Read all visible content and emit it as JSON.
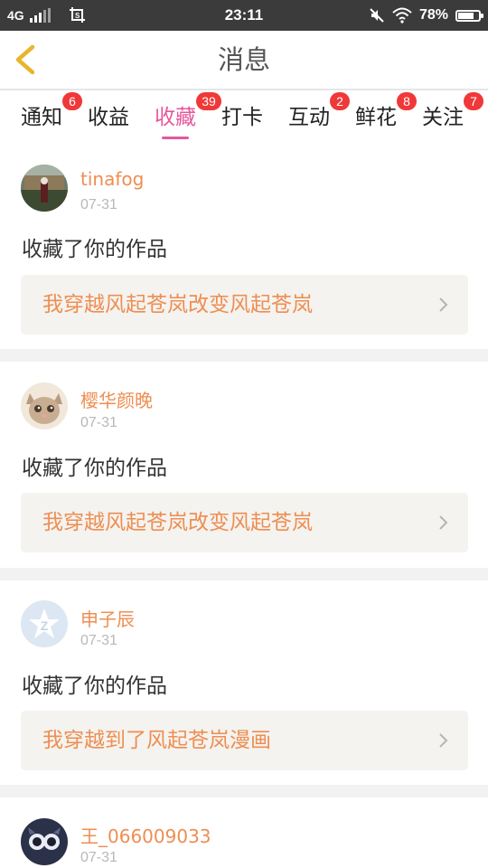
{
  "status_bar": {
    "network": "4G",
    "time": "23:11",
    "battery": "78%",
    "battery_level": 0.78
  },
  "header": {
    "title": "消息",
    "back_icon": "chevron-left-icon"
  },
  "tabs": [
    {
      "label": "通知",
      "badge": "6",
      "active": false
    },
    {
      "label": "收益",
      "badge": "",
      "active": false
    },
    {
      "label": "收藏",
      "badge": "39",
      "active": true
    },
    {
      "label": "打卡",
      "badge": "",
      "active": false
    },
    {
      "label": "互动",
      "badge": "2",
      "active": false
    },
    {
      "label": "鲜花",
      "badge": "8",
      "active": false
    },
    {
      "label": "关注",
      "badge": "7",
      "active": false
    }
  ],
  "notifications": [
    {
      "user": "tinafog",
      "date": "07-31",
      "action": "收藏了你的作品",
      "work": "我穿越风起苍岚改变风起苍岚",
      "avatar": "photo-avatar"
    },
    {
      "user": "樱华颜晚",
      "date": "07-31",
      "action": "收藏了你的作品",
      "work": "我穿越风起苍岚改变风起苍岚",
      "avatar": "cat-avatar"
    },
    {
      "user": "申子辰",
      "date": "07-31",
      "action": "收藏了你的作品",
      "work": "我穿越到了风起苍岚漫画",
      "avatar": "default-avatar"
    },
    {
      "user": "王_066009033",
      "date": "07-31",
      "action": "",
      "work": "",
      "avatar": "owl-avatar"
    }
  ],
  "colors": {
    "accent": "#e6579c",
    "username": "#ee8e52",
    "badge": "#f03838",
    "back_icon": "#e8b52c"
  }
}
